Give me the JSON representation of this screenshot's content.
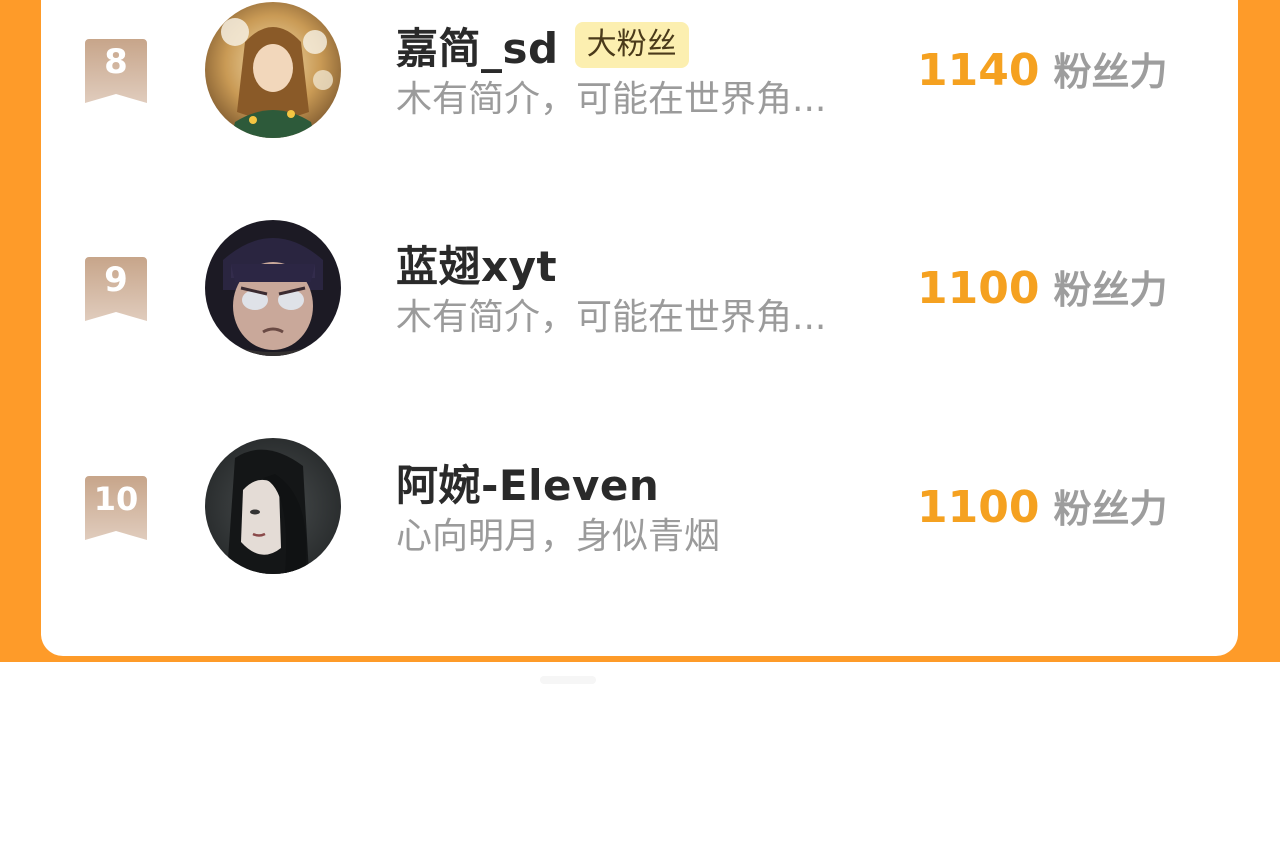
{
  "ranking": {
    "entries": [
      {
        "rank": "8",
        "name": "嘉简_sd",
        "tag": "大粉丝",
        "bio": "木有简介，可能在世界角...",
        "score": "1140",
        "score_unit": "粉丝力"
      },
      {
        "rank": "9",
        "name": "蓝翅xyt",
        "tag": "",
        "bio": "木有简介，可能在世界角...",
        "score": "1100",
        "score_unit": "粉丝力"
      },
      {
        "rank": "10",
        "name": "阿婉-Eleven",
        "tag": "",
        "bio": "心向明月，身似青烟",
        "score": "1100",
        "score_unit": "粉丝力"
      }
    ]
  },
  "colors": {
    "accent": "#fe9b29",
    "score": "#f5a120",
    "badge": "#c9ad97",
    "tag_bg": "#fcefb0"
  }
}
